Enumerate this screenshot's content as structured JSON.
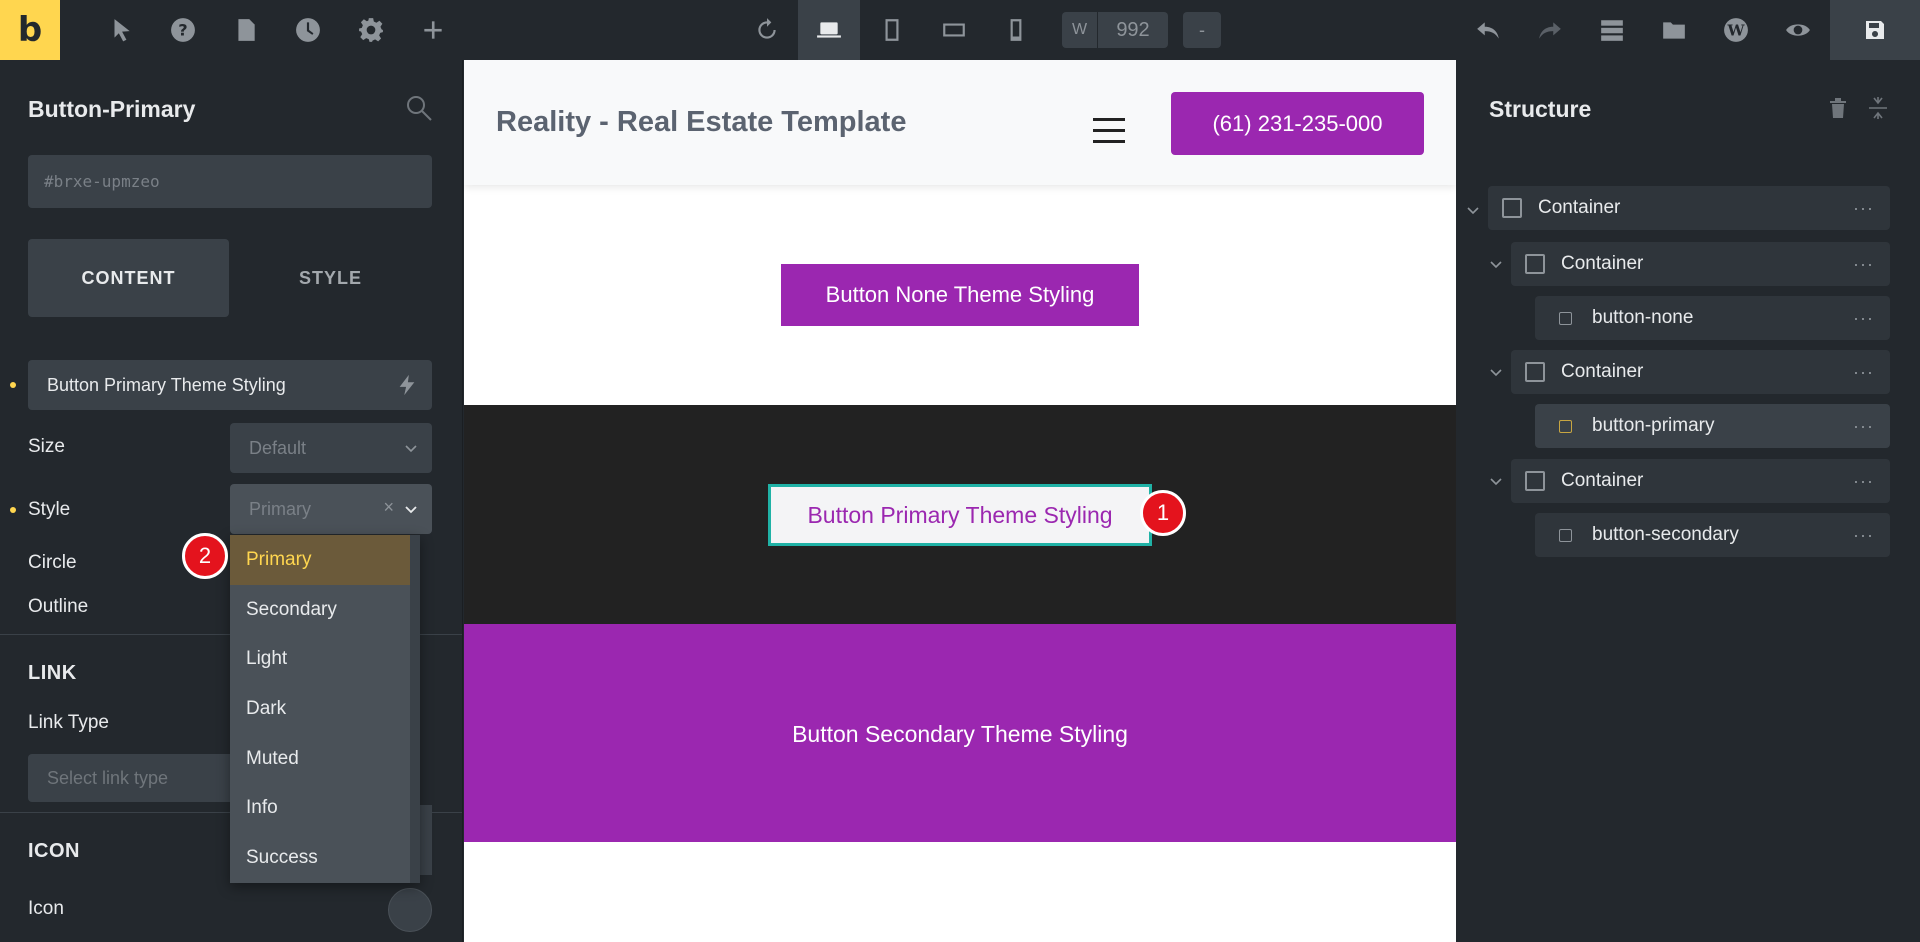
{
  "toolbar": {
    "logo": "b",
    "width_label": "W",
    "width_value": "992",
    "minus": "-"
  },
  "panel": {
    "title": "Button-Primary",
    "id_placeholder": "#brxe-upmzeo",
    "tabs": {
      "content": "CONTENT",
      "style": "STYLE"
    },
    "text_value": "Button Primary Theme Styling",
    "size_label": "Size",
    "size_value": "Default",
    "style_label": "Style",
    "style_value": "Primary",
    "circle_label": "Circle",
    "outline_label": "Outline",
    "link_section": "LINK",
    "link_type_label": "Link Type",
    "link_type_placeholder": "Select link type",
    "icon_section": "ICON",
    "icon_label": "Icon"
  },
  "dropdown": {
    "options": [
      "Primary",
      "Secondary",
      "Light",
      "Dark",
      "Muted",
      "Info",
      "Success"
    ],
    "selected": "Primary"
  },
  "badges": {
    "one": "1",
    "two": "2"
  },
  "canvas": {
    "site_title": "Reality - Real Estate Template",
    "phone": "(61) 231-235-000",
    "btn_none": "Button None Theme Styling",
    "btn_primary": "Button Primary Theme Styling",
    "btn_secondary": "Button Secondary Theme Styling"
  },
  "structure": {
    "title": "Structure",
    "items": [
      {
        "label": "Container"
      },
      {
        "label": "Container"
      },
      {
        "label": "button-none"
      },
      {
        "label": "Container"
      },
      {
        "label": "button-primary"
      },
      {
        "label": "Container"
      },
      {
        "label": "button-secondary"
      }
    ],
    "more": "···"
  }
}
